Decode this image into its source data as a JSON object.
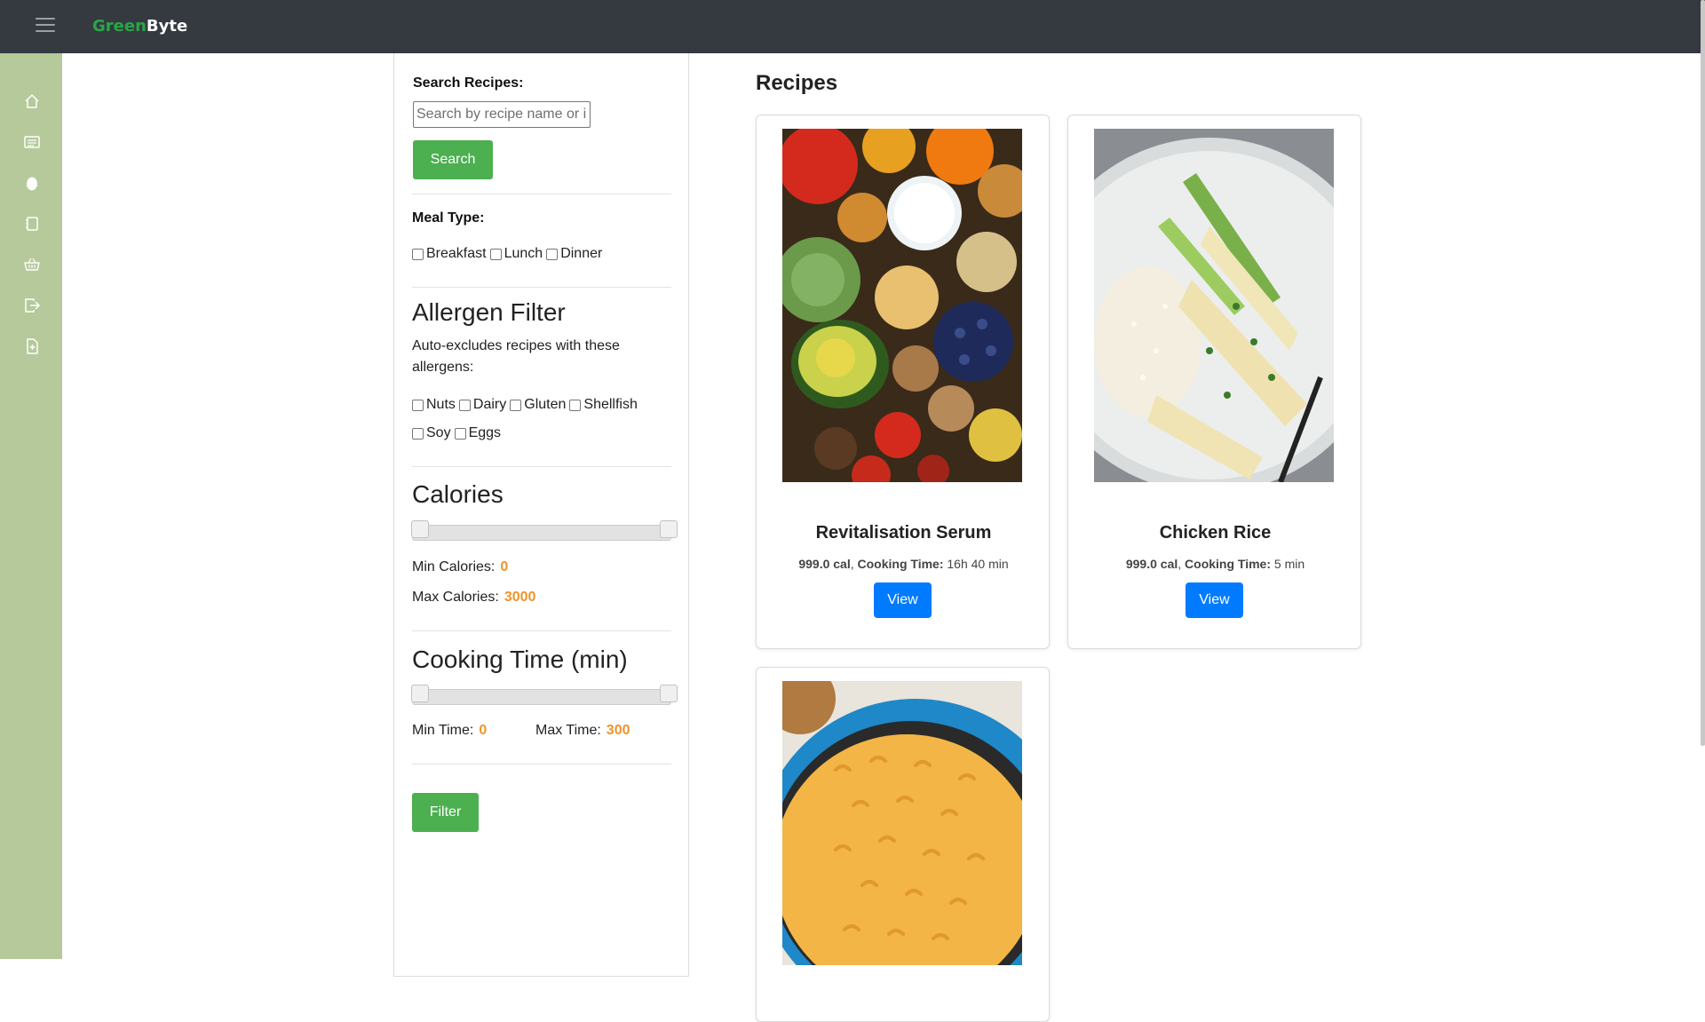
{
  "brand": {
    "part1": "Green",
    "part2": "Byte"
  },
  "sidebar": {
    "items": [
      {
        "icon": "home-icon"
      },
      {
        "icon": "news-icon"
      },
      {
        "icon": "egg-icon"
      },
      {
        "icon": "notebook-icon"
      },
      {
        "icon": "basket-icon"
      },
      {
        "icon": "logout-icon"
      },
      {
        "icon": "add-file-icon"
      }
    ]
  },
  "filters": {
    "search_label": "Search Recipes:",
    "search_placeholder": "Search by recipe name or ingredient",
    "search_button": "Search",
    "meal_type_label": "Meal Type:",
    "meal_types": [
      "Breakfast",
      "Lunch",
      "Dinner"
    ],
    "allergen_title": "Allergen Filter",
    "allergen_desc": "Auto-excludes recipes with these allergens:",
    "allergens_row1": [
      "Nuts",
      "Dairy",
      "Gluten",
      "Shellfish"
    ],
    "allergens_row2": [
      "Soy",
      "Eggs"
    ],
    "calories_title": "Calories",
    "min_calories_label": "Min Calories:",
    "min_calories": "0",
    "max_calories_label": "Max Calories:",
    "max_calories": "3000",
    "cooking_title": "Cooking Time (min)",
    "min_time_label": "Min Time:",
    "min_time": "0",
    "max_time_label": "Max Time:",
    "max_time": "300",
    "filter_button": "Filter"
  },
  "main": {
    "title": "Recipes",
    "recipes": [
      {
        "name": "Revitalisation Serum",
        "calories": "999.0 cal",
        "cooking_label": "Cooking Time:",
        "cooking_time": "16h 40 min",
        "button": "View"
      },
      {
        "name": "Chicken Rice",
        "calories": "999.0 cal",
        "cooking_label": "Cooking Time:",
        "cooking_time": "5 min",
        "button": "View"
      },
      {
        "name": "",
        "calories": "",
        "cooking_label": "",
        "cooking_time": "",
        "button": ""
      }
    ]
  },
  "colors": {
    "navbar": "#343a40",
    "sidebar": "#b5c99a",
    "brand_green": "#28a745",
    "button_green": "#4caf50",
    "button_blue": "#007bff",
    "accent_orange": "#f0932b"
  }
}
